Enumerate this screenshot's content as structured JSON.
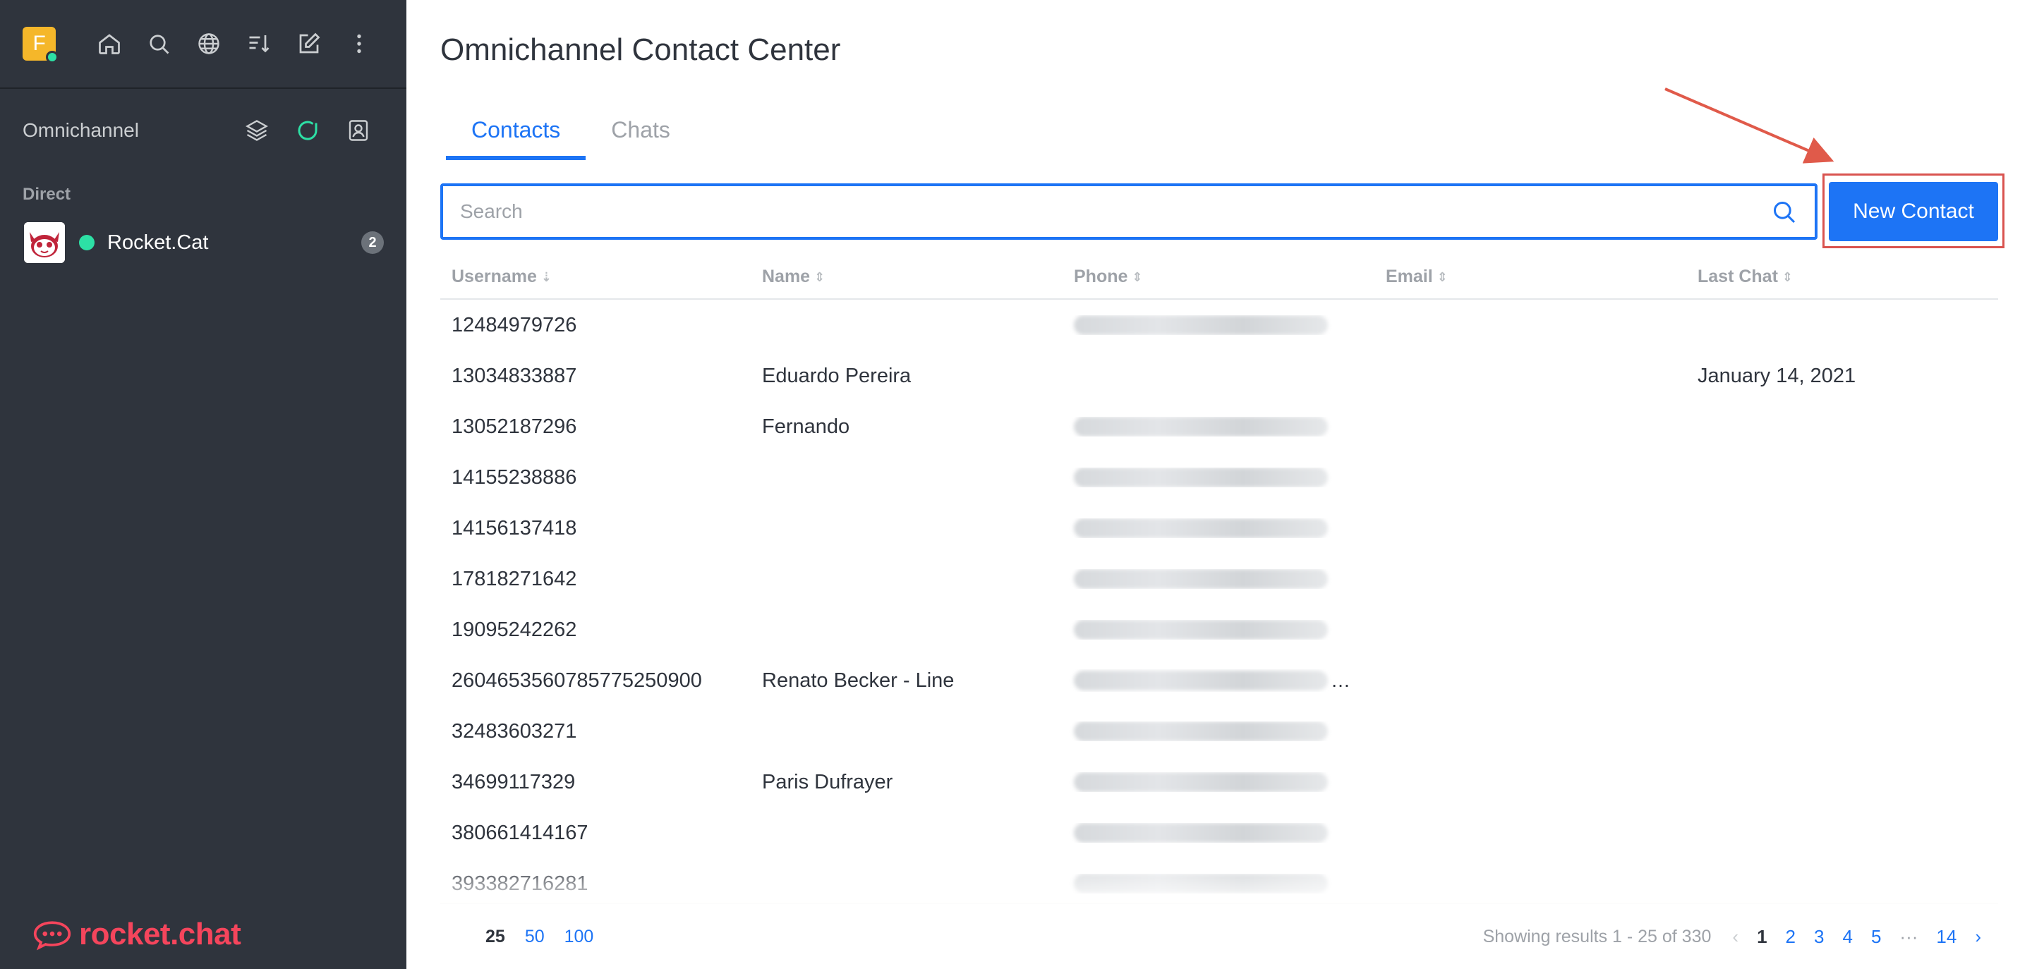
{
  "sidebar": {
    "logo_letter": "F",
    "top_icons": [
      "home-icon",
      "search-icon",
      "directory-icon",
      "sort-icon",
      "create-new-icon",
      "kebab-menu-icon"
    ],
    "omnichannel_label": "Omnichannel",
    "section_direct": "Direct",
    "rooms": [
      {
        "name": "Rocket.Cat",
        "unread": "2",
        "status": "online"
      }
    ],
    "brand": "rocket.chat"
  },
  "main": {
    "title": "Omnichannel Contact Center",
    "tabs": [
      {
        "label": "Contacts",
        "active": true
      },
      {
        "label": "Chats",
        "active": false
      }
    ],
    "search": {
      "placeholder": "Search",
      "value": ""
    },
    "new_contact_label": "New Contact",
    "table": {
      "columns": [
        "Username",
        "Name",
        "Phone",
        "Email",
        "Last Chat"
      ],
      "rows": [
        {
          "username": "12484979726",
          "name": "",
          "phone_blurred": true,
          "email": "",
          "last_chat": ""
        },
        {
          "username": "13034833887",
          "name": "Eduardo Pereira",
          "phone_blurred": false,
          "email": "",
          "last_chat": "January 14, 2021"
        },
        {
          "username": "13052187296",
          "name": "Fernando",
          "phone_blurred": true,
          "email": "",
          "last_chat": ""
        },
        {
          "username": "14155238886",
          "name": "",
          "phone_blurred": true,
          "email": "",
          "last_chat": ""
        },
        {
          "username": "14156137418",
          "name": "",
          "phone_blurred": true,
          "email": "",
          "last_chat": ""
        },
        {
          "username": "17818271642",
          "name": "",
          "phone_blurred": true,
          "email": "",
          "last_chat": ""
        },
        {
          "username": "19095242262",
          "name": "",
          "phone_blurred": true,
          "email": "",
          "last_chat": ""
        },
        {
          "username": "2604653560785775250900",
          "name": "Renato Becker - Line",
          "phone_blurred": true,
          "phone_truncated": true,
          "email": "",
          "last_chat": ""
        },
        {
          "username": "32483603271",
          "name": "",
          "phone_blurred": true,
          "email": "",
          "last_chat": ""
        },
        {
          "username": "34699117329",
          "name": "Paris Dufrayer",
          "phone_blurred": true,
          "email": "",
          "last_chat": ""
        },
        {
          "username": "380661414167",
          "name": "",
          "phone_blurred": true,
          "email": "",
          "last_chat": ""
        },
        {
          "username": "393382716281",
          "name": "",
          "phone_blurred": true,
          "email": "",
          "last_chat": ""
        }
      ]
    },
    "footer": {
      "per_page": [
        "25",
        "50",
        "100"
      ],
      "per_page_current": "25",
      "results_text": "Showing results 1 - 25 of 330",
      "pages": [
        "1",
        "2",
        "3",
        "4",
        "5",
        "···",
        "14"
      ],
      "current_page": "1",
      "prev_icon": "‹",
      "next_icon": "›"
    }
  },
  "colors": {
    "accent": "#1d74f5",
    "sidebar_bg": "#2f343d",
    "highlight": "#d9534f",
    "online": "#2de0a5",
    "brand_red": "#f5455c"
  }
}
